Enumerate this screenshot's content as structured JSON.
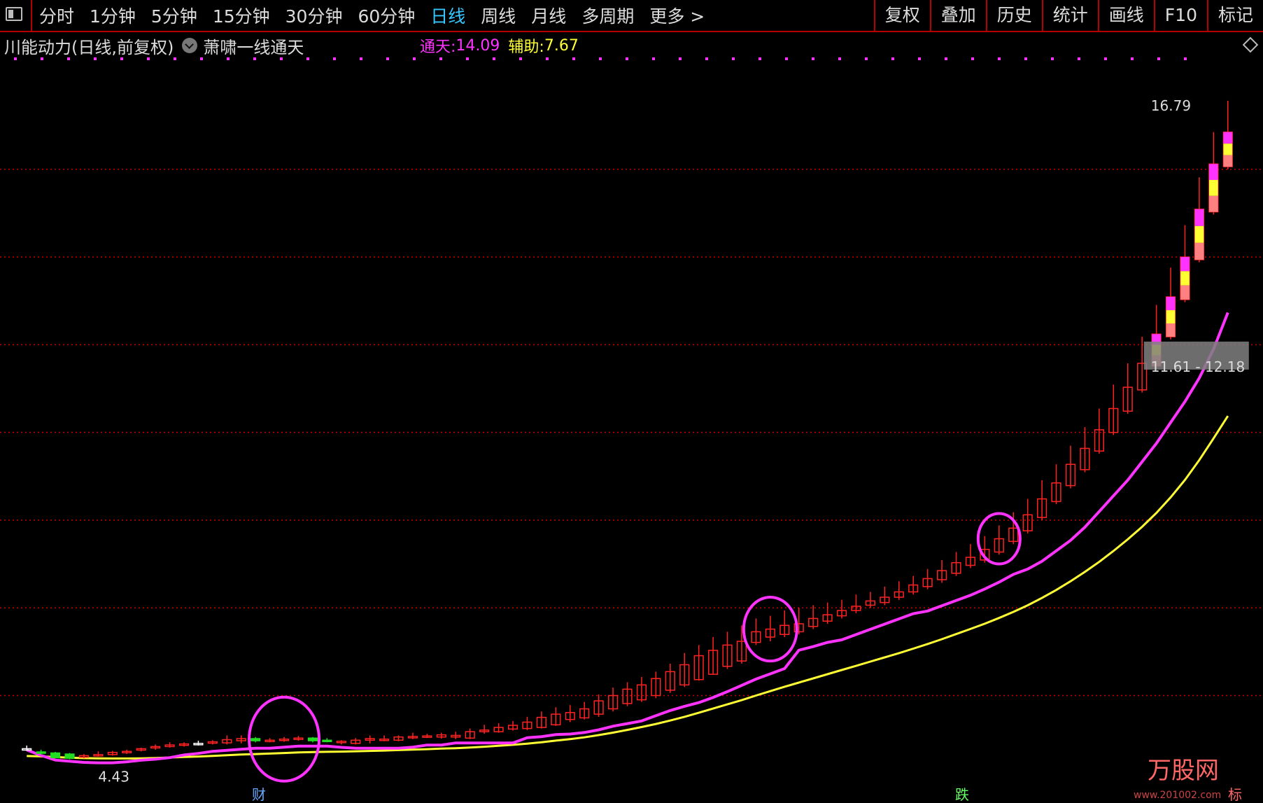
{
  "toolbar": {
    "periods": [
      "分时",
      "1分钟",
      "5分钟",
      "15分钟",
      "30分钟",
      "60分钟",
      "日线",
      "周线",
      "月线",
      "多周期",
      "更多 >"
    ],
    "active_period": "日线",
    "right_items": [
      "复权",
      "叠加",
      "历史",
      "统计",
      "画线",
      "F10",
      "标记"
    ]
  },
  "title": {
    "main": "川能动力(日线,前复权)",
    "indicator": "萧啸一线通天"
  },
  "legend": {
    "name1": "通天:",
    "value1": "14.09",
    "name2": "辅助:",
    "value2": "7.67"
  },
  "colors": {
    "up": "#ff2222",
    "down": "#22dd22",
    "flat": "#ffffff",
    "tongtian": "#ff33ff",
    "fuzhu": "#ffff33",
    "grid": "#c80000",
    "signal_pink": "#ff33ff",
    "signal_yellow": "#ffff33",
    "signal_salmon": "#ff8080"
  },
  "annotations": {
    "high_label": "16.79",
    "low_label": "4.43",
    "range_label": "11.61 - 12.18",
    "bottom_mark1": "财",
    "bottom_mark2": "跌",
    "bottom_mark3": "标",
    "watermark": "万股网",
    "watermark_sub": "www.201002.com"
  },
  "chart_data": {
    "type": "candlestick",
    "y_axis": "price",
    "ylim": [
      4.0,
      17.5
    ],
    "gridlines": [
      15.5,
      13.85,
      12.2,
      10.55,
      8.9,
      7.25,
      5.6
    ],
    "candles": [
      [
        4.6,
        4.6,
        4.66,
        4.56
      ],
      [
        4.54,
        4.52,
        4.58,
        4.49
      ],
      [
        4.52,
        4.43,
        4.54,
        4.43
      ],
      [
        4.5,
        4.42,
        4.52,
        4.4
      ],
      [
        4.44,
        4.47,
        4.5,
        4.42
      ],
      [
        4.47,
        4.49,
        4.55,
        4.45
      ],
      [
        4.49,
        4.53,
        4.56,
        4.47
      ],
      [
        4.54,
        4.55,
        4.58,
        4.5
      ],
      [
        4.58,
        4.6,
        4.62,
        4.55
      ],
      [
        4.62,
        4.64,
        4.68,
        4.58
      ],
      [
        4.64,
        4.67,
        4.72,
        4.62
      ],
      [
        4.67,
        4.69,
        4.72,
        4.64
      ],
      [
        4.7,
        4.7,
        4.75,
        4.66
      ],
      [
        4.71,
        4.73,
        4.76,
        4.68
      ],
      [
        4.71,
        4.77,
        4.85,
        4.68
      ],
      [
        4.75,
        4.79,
        4.85,
        4.7
      ],
      [
        4.79,
        4.75,
        4.82,
        4.72
      ],
      [
        4.75,
        4.76,
        4.8,
        4.72
      ],
      [
        4.76,
        4.78,
        4.82,
        4.73
      ],
      [
        4.78,
        4.8,
        4.84,
        4.75
      ],
      [
        4.8,
        4.75,
        4.82,
        4.72
      ],
      [
        4.76,
        4.74,
        4.8,
        4.72
      ],
      [
        4.72,
        4.74,
        4.76,
        4.68
      ],
      [
        4.7,
        4.76,
        4.8,
        4.68
      ],
      [
        4.76,
        4.79,
        4.85,
        4.7
      ],
      [
        4.76,
        4.78,
        4.85,
        4.74
      ],
      [
        4.76,
        4.82,
        4.85,
        4.74
      ],
      [
        4.81,
        4.83,
        4.9,
        4.78
      ],
      [
        4.83,
        4.84,
        4.88,
        4.8
      ],
      [
        4.82,
        4.86,
        4.9,
        4.79
      ],
      [
        4.82,
        4.85,
        4.92,
        4.78
      ],
      [
        4.8,
        4.92,
        4.98,
        4.78
      ],
      [
        4.92,
        4.95,
        5.05,
        4.88
      ],
      [
        4.92,
        5.0,
        5.08,
        4.9
      ],
      [
        4.97,
        5.04,
        5.12,
        4.94
      ],
      [
        4.98,
        5.1,
        5.2,
        4.95
      ],
      [
        5.0,
        5.19,
        5.3,
        4.98
      ],
      [
        5.05,
        5.25,
        5.38,
        5.03
      ],
      [
        5.15,
        5.28,
        5.42,
        5.1
      ],
      [
        5.18,
        5.35,
        5.48,
        5.15
      ],
      [
        5.25,
        5.5,
        5.62,
        5.2
      ],
      [
        5.35,
        5.6,
        5.75,
        5.3
      ],
      [
        5.45,
        5.72,
        5.85,
        5.4
      ],
      [
        5.52,
        5.8,
        5.95,
        5.48
      ],
      [
        5.6,
        5.92,
        6.05,
        5.55
      ],
      [
        5.7,
        6.05,
        6.2,
        5.65
      ],
      [
        5.8,
        6.18,
        6.4,
        5.76
      ],
      [
        5.9,
        6.35,
        6.55,
        5.88
      ],
      [
        6.0,
        6.45,
        6.7,
        6.0
      ],
      [
        6.15,
        6.55,
        6.8,
        6.1
      ],
      [
        6.25,
        6.62,
        6.92,
        6.2
      ],
      [
        6.6,
        6.8,
        7.05,
        6.55
      ],
      [
        6.7,
        6.85,
        7.1,
        6.62
      ],
      [
        6.75,
        6.92,
        7.2,
        6.7
      ],
      [
        6.8,
        6.95,
        7.25,
        6.75
      ],
      [
        6.9,
        7.05,
        7.3,
        6.85
      ],
      [
        7.0,
        7.12,
        7.35,
        6.95
      ],
      [
        7.1,
        7.2,
        7.4,
        7.05
      ],
      [
        7.2,
        7.28,
        7.5,
        7.15
      ],
      [
        7.3,
        7.38,
        7.55,
        7.25
      ],
      [
        7.35,
        7.45,
        7.65,
        7.3
      ],
      [
        7.45,
        7.55,
        7.75,
        7.4
      ],
      [
        7.55,
        7.68,
        7.85,
        7.5
      ],
      [
        7.65,
        7.8,
        7.98,
        7.6
      ],
      [
        7.78,
        7.95,
        8.15,
        7.72
      ],
      [
        7.9,
        8.1,
        8.3,
        7.85
      ],
      [
        8.05,
        8.2,
        8.45,
        8.0
      ],
      [
        8.15,
        8.35,
        8.6,
        8.1
      ],
      [
        8.3,
        8.55,
        8.8,
        8.25
      ],
      [
        8.5,
        8.75,
        9.05,
        8.45
      ],
      [
        8.7,
        9.0,
        9.3,
        8.65
      ],
      [
        8.95,
        9.3,
        9.65,
        8.9
      ],
      [
        9.25,
        9.6,
        9.95,
        9.2
      ],
      [
        9.55,
        9.95,
        10.3,
        9.5
      ],
      [
        9.85,
        10.25,
        10.65,
        9.8
      ],
      [
        10.2,
        10.6,
        11.0,
        10.15
      ],
      [
        10.55,
        11.0,
        11.45,
        10.5
      ],
      [
        10.95,
        11.4,
        11.85,
        10.9
      ],
      [
        11.35,
        11.85,
        12.35,
        11.3
      ],
      [
        11.8,
        12.4,
        12.95,
        11.75
      ],
      [
        12.35,
        13.1,
        13.65,
        12.3
      ],
      [
        13.05,
        13.85,
        14.45,
        13.0
      ],
      [
        13.8,
        14.75,
        15.35,
        13.75
      ],
      [
        14.7,
        15.6,
        16.2,
        14.65
      ],
      [
        15.55,
        16.2,
        16.79,
        15.5
      ]
    ],
    "series": [
      {
        "name": "通天",
        "color": "#ff33ff"
      },
      {
        "name": "辅助",
        "color": "#ffff33"
      }
    ]
  }
}
